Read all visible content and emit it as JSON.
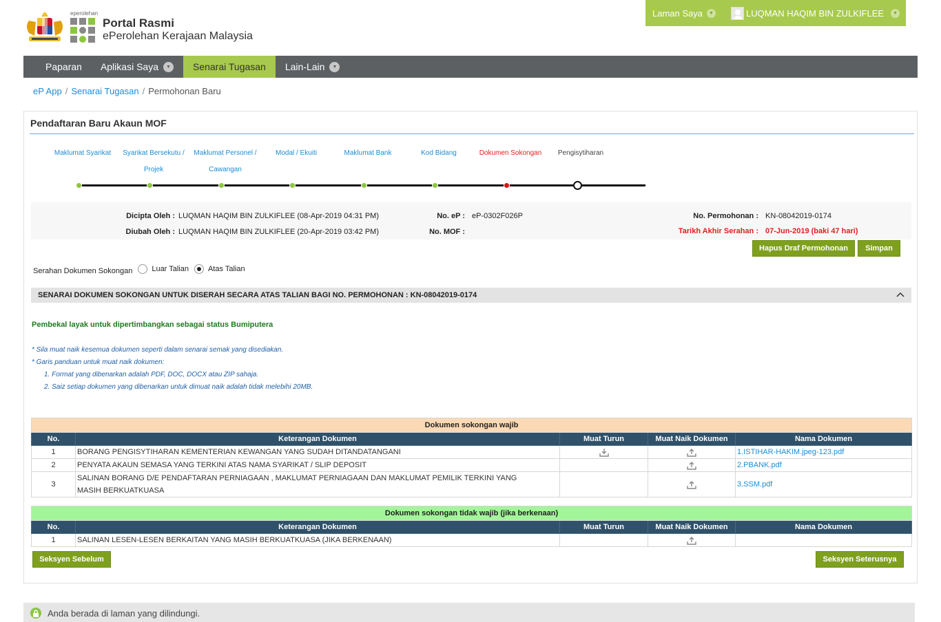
{
  "header": {
    "logo_small": "eperolehan",
    "title": "Portal Rasmi",
    "subtitle": "ePerolehan Kerajaan Malaysia",
    "laman_saya": "Laman Saya",
    "user_name": "LUQMAN HAQIM BIN ZULKIFLEE"
  },
  "nav": {
    "items": [
      {
        "label": "Paparan"
      },
      {
        "label": "Aplikasi Saya"
      },
      {
        "label": "Senarai Tugasan"
      },
      {
        "label": "Lain-Lain"
      }
    ],
    "active_index": 2
  },
  "breadcrumb": {
    "items": [
      "eP App",
      "Senarai Tugasan",
      "Permohonan Baru"
    ],
    "separator": "/"
  },
  "panel": {
    "title": "Pendaftaran Baru Akaun MOF"
  },
  "wizard": {
    "steps": [
      {
        "line1": "Maklumat Syarikat",
        "line2": "",
        "state": "done"
      },
      {
        "line1": "Syarikat Bersekutu /",
        "line2": "Projek",
        "state": "done"
      },
      {
        "line1": "Maklumat Personel /",
        "line2": "Cawangan",
        "state": "done"
      },
      {
        "line1": "Modal / Ekuiti",
        "line2": "",
        "state": "done"
      },
      {
        "line1": "Maklumat Bank",
        "line2": "",
        "state": "done"
      },
      {
        "line1": "Kod Bidang",
        "line2": "",
        "state": "done"
      },
      {
        "line1": "Dokumen Sokongan",
        "line2": "",
        "state": "current"
      },
      {
        "line1": "Pengisytiharan",
        "line2": "",
        "state": "pending"
      }
    ]
  },
  "info": {
    "dicipta_label": "Dicipta Oleh :",
    "dicipta_value": "LUQMAN HAQIM BIN ZULKIFLEE (08-Apr-2019 04:31 PM)",
    "diubah_label": "Diubah Oleh :",
    "diubah_value": "LUQMAN HAQIM BIN ZULKIFLEE (20-Apr-2019 03:42 PM)",
    "no_ep_label": "No. eP :",
    "no_ep_value": "eP-0302F026P",
    "no_mof_label": "No. MOF :",
    "no_mof_value": "",
    "no_permohonan_label": "No. Permohonan :",
    "no_permohonan_value": "KN-08042019-0174",
    "tarikh_label": "Tarikh Akhir Serahan :",
    "tarikh_value": "07-Jun-2019 (baki 47 hari)"
  },
  "buttons": {
    "hapus": "Hapus Draf Permohonan",
    "simpan": "Simpan",
    "sebelum": "Seksyen Sebelum",
    "seterusnya": "Seksyen Seterusnya"
  },
  "serahan": {
    "label": "Serahan Dokumen Sokongan",
    "option_luar": "Luar Talian",
    "option_atas": "Atas Talian",
    "selected": "Atas Talian"
  },
  "section": {
    "title": "SENARAI DOKUMEN SOKONGAN UNTUK DISERAH SECARA ATAS TALIAN BAGI NO. PERMOHONAN :  KN-08042019-0174"
  },
  "bumiputera_note": "Pembekal layak untuk dipertimbangkan sebagai status Bumiputera",
  "notes": {
    "line1": "* Sila muat naik kesemua dokumen seperti dalam senarai semak yang disediakan.",
    "line2": "* Garis panduan untuk muat naik dokumen:",
    "line3": "1. Format yang dibenarkan adalah PDF, DOC, DOCX atau ZIP sahaja.",
    "line4": "2. Saiz setiap dokumen yang dibenarkan untuk dimuat naik adalah tidak melebihi 20MB."
  },
  "table_headers": {
    "no": "No.",
    "keterangan": "Keterangan Dokumen",
    "muat_turun": "Muat Turun",
    "muat_naik": "Muat Naik Dokumen",
    "nama": "Nama Dokumen"
  },
  "wajib": {
    "caption": "Dokumen sokongan wajib",
    "caption_color": "#fcd9b5",
    "rows": [
      {
        "no": "1",
        "desc": "BORANG PENGISYTIHARAN KEMENTERIAN KEWANGAN YANG SUDAH DITANDATANGANI",
        "download": true,
        "file": "1.ISTIHAR-HAKIM.jpeg-123.pdf"
      },
      {
        "no": "2",
        "desc": "PENYATA AKAUN SEMASA YANG TERKINI ATAS NAMA SYARIKAT / SLIP DEPOSIT",
        "download": false,
        "file": "2.PBANK.pdf"
      },
      {
        "no": "3",
        "desc": "SALINAN BORANG D/E PENDAFTARAN PERNIAGAAN , MAKLUMAT PERNIAGAAN DAN MAKLUMAT PEMILIK TERKINI YANG MASIH BERKUATKUASA",
        "download": false,
        "file": "3.SSM.pdf"
      }
    ]
  },
  "tidak_wajib": {
    "caption": "Dokumen sokongan tidak wajib (jika berkenaan)",
    "caption_color": "#a3f59a",
    "rows": [
      {
        "no": "1",
        "desc": "SALINAN LESEN-LESEN BERKAITAN YANG MASIH BERKUATKUASA (JIKA BERKENAAN)",
        "download": false,
        "file": ""
      }
    ]
  },
  "footer": {
    "text": "Anda berada di laman yang dilindungi."
  },
  "colors": {
    "accent_green": "#a7c94d",
    "nav_bg": "#5d6063",
    "table_header": "#2f5169",
    "link_blue": "#1a8dd6",
    "error_red": "#e02020"
  }
}
